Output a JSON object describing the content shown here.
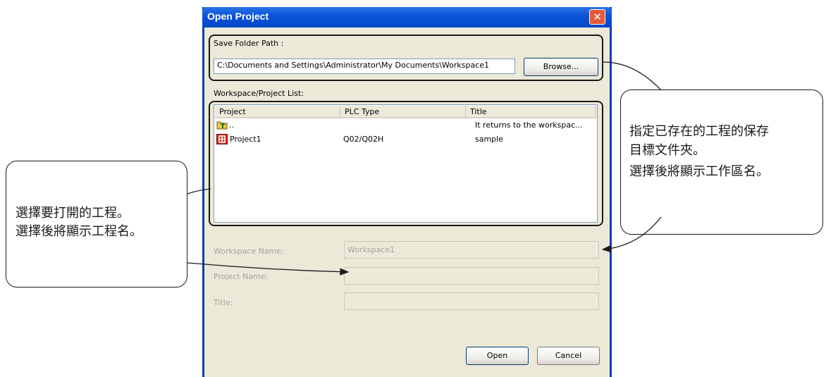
{
  "dialog": {
    "title": "Open Project",
    "close_glyph": "✕",
    "save_folder_label": "Save Folder Path :",
    "save_folder_value": "C:\\Documents and Settings\\Administrator\\My Documents\\Workspace1",
    "browse_label": "Browse...",
    "list_label": "Workspace/Project List:",
    "columns": [
      "Project",
      "PLC Type",
      "Title"
    ],
    "rows": [
      {
        "project": "..",
        "plc": "",
        "title": "It returns to the workspac...",
        "icon": "folder-up-icon"
      },
      {
        "project": "Project1",
        "plc": "Q02/Q02H",
        "title": "sample",
        "icon": "plc-project-icon"
      }
    ],
    "workspace_name_label": "Workspace Name:",
    "workspace_name_value": "Workspace1",
    "project_name_label": "Project Name:",
    "project_name_value": "",
    "title_label": "Title:",
    "title_value": "",
    "open_label": "Open",
    "cancel_label": "Cancel"
  },
  "callouts": {
    "left": [
      "選擇要打開的工程。",
      "選擇後將顯示工程名。"
    ],
    "right": [
      "指定已存在的工程的保存",
      "目標文件夾。",
      "選擇後將顯示工作區名。"
    ]
  },
  "colors": {
    "titlebar": "#0a55d8",
    "dialog_bg": "#ece9d8",
    "close_button": "#e45a3c",
    "disabled_text": "#a6a49a"
  }
}
